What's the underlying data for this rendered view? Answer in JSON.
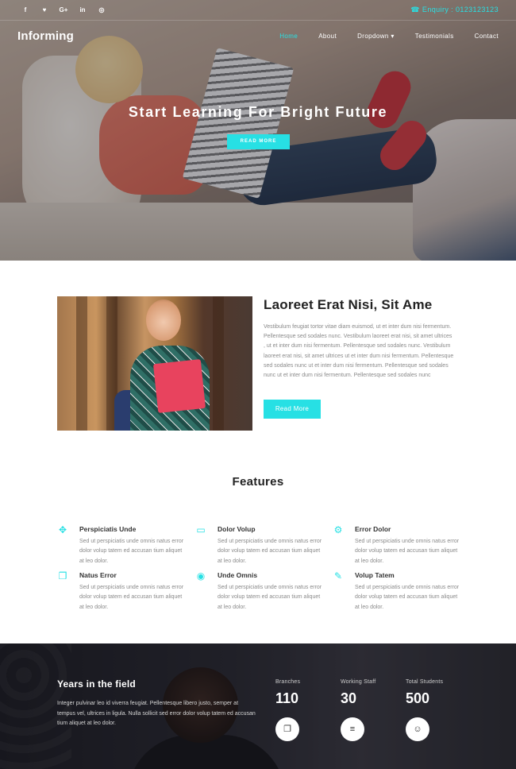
{
  "topbar": {
    "social": [
      {
        "icon": "facebook-icon",
        "glyph": "f"
      },
      {
        "icon": "twitter-icon",
        "glyph": "♥"
      },
      {
        "icon": "google-plus-icon",
        "glyph": "G+"
      },
      {
        "icon": "linkedin-icon",
        "glyph": "in"
      },
      {
        "icon": "dribbble-icon",
        "glyph": "◎"
      }
    ],
    "enquiry_icon": "☎",
    "enquiry": "Enquiry : 0123123123"
  },
  "header": {
    "brand": "Informing",
    "nav": [
      "Home",
      "About",
      "Dropdown ▾",
      "Testimonials",
      "Contact"
    ],
    "active_nav": "Home"
  },
  "hero": {
    "title": "Start Learning For Bright Future",
    "button": "READ MORE"
  },
  "about": {
    "title": "Laoreet Erat Nisi, Sit Ame",
    "text": "Vestibulum feugiat tortor vitae diam euismod, ut et inter dum nisi fermentum. Pellentesque sed sodales nunc. Vestibulum laoreet erat nisi, sit amet ultrices , ut et inter dum nisi fermentum. Pellentesque sed sodales nunc. Vestibulum laoreet erat nisi, sit amet ultrices ut et inter dum nisi fermentum. Pellentesque sed sodales nunc ut et inter dum nisi fermentum. Pellentesque sed sodales nunc ut et inter dum nisi fermentum. Pellentesque sed sodales nunc",
    "button": "Read More"
  },
  "features": {
    "title": "Features",
    "items": [
      {
        "icon": "move-icon",
        "glyph": "✥",
        "title": "Perspiciatis Unde",
        "text": "Sed ut perspiciatis unde omnis natus error dolor volup tatem ed accusan tium aliquet at leo dolor."
      },
      {
        "icon": "laptop-icon",
        "glyph": "▭",
        "title": "Dolor Volup",
        "text": "Sed ut perspiciatis unde omnis natus error dolor volup tatem ed accusan tium aliquet at leo dolor."
      },
      {
        "icon": "gear-icon",
        "glyph": "⚙",
        "title": "Error Dolor",
        "text": "Sed ut perspiciatis unde omnis natus error dolor volup tatem ed accusan tium aliquet at leo dolor."
      },
      {
        "icon": "copy-icon",
        "glyph": "❐",
        "title": "Natus Error",
        "text": "Sed ut perspiciatis unde omnis natus error dolor volup tatem ed accusan tium aliquet at leo dolor."
      },
      {
        "icon": "eye-icon",
        "glyph": "◉",
        "title": "Unde Omnis",
        "text": "Sed ut perspiciatis unde omnis natus error dolor volup tatem ed accusan tium aliquet at leo dolor."
      },
      {
        "icon": "brush-icon",
        "glyph": "✎",
        "title": "Volup Tatem",
        "text": "Sed ut perspiciatis unde omnis natus error dolor volup tatem ed accusan tium aliquet at leo dolor."
      }
    ]
  },
  "stats": {
    "title": "Years in the field",
    "text": "Integer pulvinar leo id viverra feugiat. Pellentesque libero justo, semper at tempus vel, ultrices in ligula. Nulla sollicit sed error dolor volup tatem ed accusan tium aliquet at leo dolor.",
    "items": [
      {
        "label": "Branches",
        "value": "110",
        "icon": "clone-icon",
        "glyph": "❐"
      },
      {
        "label": "Working Staff",
        "value": "30",
        "icon": "list-icon",
        "glyph": "≡"
      },
      {
        "label": "Total Students",
        "value": "500",
        "icon": "users-icon",
        "glyph": "☺"
      }
    ]
  },
  "colors": {
    "accent": "#27e0e4",
    "dark": "#222222",
    "stats_bg": "#2a2a33"
  }
}
